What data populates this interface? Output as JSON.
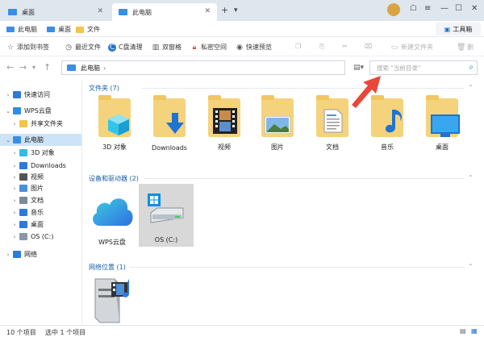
{
  "tabs": [
    {
      "label": "桌面",
      "active": false
    },
    {
      "label": "此电脑",
      "active": true
    }
  ],
  "bookmarks": [
    "此电脑",
    "桌面",
    "文件"
  ],
  "toolbox": "工具箱",
  "commands": [
    {
      "label": "添加到书签",
      "icon": "star-icon"
    },
    {
      "label": "最近文件",
      "icon": "clock-icon"
    },
    {
      "label": "C盘清理",
      "icon": "clean-icon"
    },
    {
      "label": "双窗格",
      "icon": "dual-pane-icon"
    },
    {
      "label": "私密空间",
      "icon": "lock-icon"
    },
    {
      "label": "快速预览",
      "icon": "eye-icon"
    },
    {
      "label": "新建文件夹",
      "icon": "new-folder-icon",
      "disabled": true
    },
    {
      "label": "删",
      "icon": "delete-icon",
      "disabled": true
    }
  ],
  "address": {
    "path": "此电脑"
  },
  "search": {
    "placeholder": "搜索 \"当前目录\""
  },
  "sidebar": {
    "items": [
      {
        "label": "快速访问",
        "level": 0,
        "color": "#2f7ad9"
      },
      {
        "label": "WPS云盘",
        "level": 0,
        "color": "#2f8de6"
      },
      {
        "label": "共享文件夹",
        "level": 1,
        "color": "#f3c44c"
      },
      {
        "label": "此电脑",
        "level": 0,
        "color": "#3a8ee6",
        "selected": true
      },
      {
        "label": "3D 对象",
        "level": 1,
        "color": "#35b9e6"
      },
      {
        "label": "Downloads",
        "level": 1,
        "color": "#2f7ad9"
      },
      {
        "label": "视频",
        "level": 1,
        "color": "#555555"
      },
      {
        "label": "图片",
        "level": 1,
        "color": "#4a90d9"
      },
      {
        "label": "文档",
        "level": 1,
        "color": "#7a8a99"
      },
      {
        "label": "音乐",
        "level": 1,
        "color": "#2f7ad9"
      },
      {
        "label": "桌面",
        "level": 1,
        "color": "#2f7ad9"
      },
      {
        "label": "OS (C:)",
        "level": 1,
        "color": "#8a97a5"
      },
      {
        "label": "网络",
        "level": 0,
        "color": "#2f7ad9"
      }
    ]
  },
  "groups": {
    "folders": {
      "title": "文件夹 (7)"
    },
    "devices": {
      "title": "设备和驱动器 (2)"
    },
    "network": {
      "title": "网络位置 (1)"
    }
  },
  "folders": [
    {
      "label": "3D 对象",
      "icon": "cube-3d-icon"
    },
    {
      "label": "Downloads",
      "icon": "download-arrow-icon"
    },
    {
      "label": "视频",
      "icon": "film-strip-icon"
    },
    {
      "label": "图片",
      "icon": "picture-icon"
    },
    {
      "label": "文档",
      "icon": "document-icon"
    },
    {
      "label": "音乐",
      "icon": "music-note-icon"
    },
    {
      "label": "桌面",
      "icon": "desktop-icon"
    }
  ],
  "devices": [
    {
      "label": "WPS云盘",
      "icon": "cloud-icon"
    },
    {
      "label": "OS (C:)",
      "icon": "hard-drive-icon",
      "selected": true
    }
  ],
  "network": [
    {
      "label": "",
      "icon": "media-server-icon"
    }
  ],
  "status": {
    "count": "10 个项目",
    "selected": "选中 1 个项目"
  },
  "colors": {
    "accent": "#1e74d0",
    "folder": "#f5d27c",
    "arrow": "#e8473a"
  }
}
